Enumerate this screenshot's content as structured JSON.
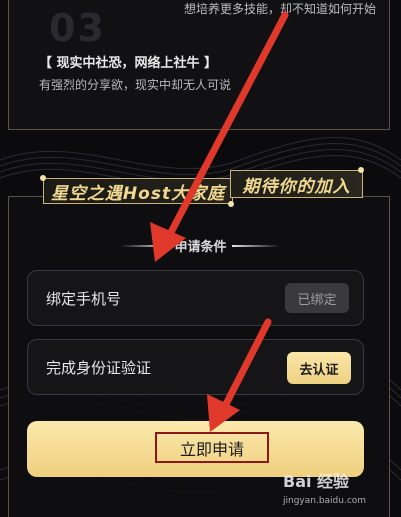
{
  "top_card": {
    "faded_number": "03",
    "top_line": "想培养更多技能，却不知道如何开始",
    "heading": "【 现实中社恐，网络上社牛 】",
    "subtext": "有强烈的分享欲，现实中却无人可说"
  },
  "banner": {
    "left_text": "星空之遇Host大家庭",
    "right_text": "期待你的加入"
  },
  "conditions": {
    "title": "申请条件",
    "rows": [
      {
        "label": "绑定手机号",
        "button": "已绑定"
      },
      {
        "label": "完成身份证验证",
        "button": "去认证"
      }
    ],
    "apply_label": "立即申请"
  },
  "watermark": {
    "text": "Bai 经验",
    "sub": "jingyan.baidu.com"
  },
  "colors": {
    "accent_gold": "#efd182",
    "annotation_red": "#e0392b"
  }
}
